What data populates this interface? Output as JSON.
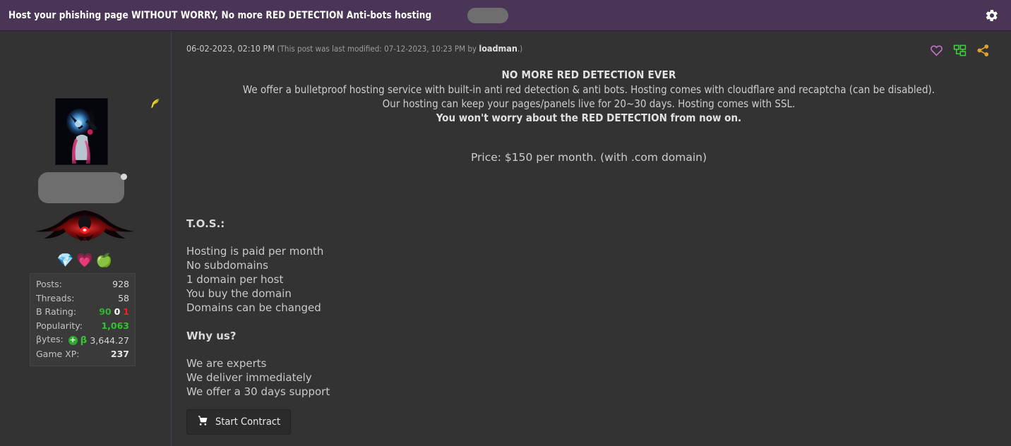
{
  "header": {
    "title": "Host your phishing page WITHOUT WORRY, No more RED DETECTION Anti-bots hosting",
    "redaction_label": "",
    "settings_icon": "gear-icon",
    "bar_color": "#4b3557"
  },
  "post": {
    "date": "06-02-2023, 02:10 PM",
    "edit_note_prefix": "(This post was last modified: 07-12-2023, 10:23 PM by ",
    "edit_note_user": "loadman",
    "edit_note_suffix": ".)",
    "actions": [
      {
        "name": "like-heart-icon",
        "label": "Like",
        "color": "#c06ec8"
      },
      {
        "name": "thread-tree-icon",
        "label": "Thread",
        "color": "#3fcc3f"
      },
      {
        "name": "share-icon",
        "label": "Share",
        "color": "#e0a02c"
      }
    ]
  },
  "author": {
    "avatar_alt": "user-avatar",
    "feather_icon": "feather-icon",
    "username_redacted": "",
    "signature_alt": "winged-emblem-signature",
    "badges": [
      {
        "name": "diamond-badge",
        "glyph": "💎"
      },
      {
        "name": "heart-badge",
        "glyph": "💗"
      },
      {
        "name": "apple-badge",
        "glyph": "🍏"
      }
    ],
    "stats": [
      {
        "label": "Posts:",
        "value": "928",
        "type": "plain"
      },
      {
        "label": "Threads:",
        "value": "58",
        "type": "plain"
      },
      {
        "label": "B Rating:",
        "value": "",
        "type": "rating",
        "positive": "90",
        "neutral": "0",
        "negative": "1"
      },
      {
        "label": "Popularity:",
        "value": "1,063",
        "type": "green"
      },
      {
        "label": "βytes:",
        "value": "3,644.27",
        "type": "bytes",
        "plus_glyph": "+",
        "beta_glyph": "β"
      },
      {
        "label": "Game XP:",
        "value": "237",
        "type": "bold"
      }
    ]
  },
  "content": {
    "heading": "NO MORE RED DETECTION EVER",
    "lines": [
      "We offer a bulletproof hosting service with built-in anti red detection & anti bots. Hosting comes with cloudflare and recaptcha (can be disabled).",
      "Our hosting can keep your pages/panels live for 20~30 days. Hosting comes with SSL."
    ],
    "bold_line": "You won't worry about the RED DETECTION from now on.",
    "price": "Price: $150 per month. (with .com domain)",
    "tos_heading": "T.O.S.:",
    "tos_items": [
      "Hosting is paid per month",
      "No subdomains",
      "1 domain per host",
      "You buy the domain",
      "Domains can be changed"
    ],
    "why_heading": "Why us?",
    "why_items": [
      "We are experts",
      "We deliver immediately",
      "We offer a 30 days support"
    ],
    "cta_label": "Start Contract",
    "cta_icon": "shopping-cart-icon"
  }
}
